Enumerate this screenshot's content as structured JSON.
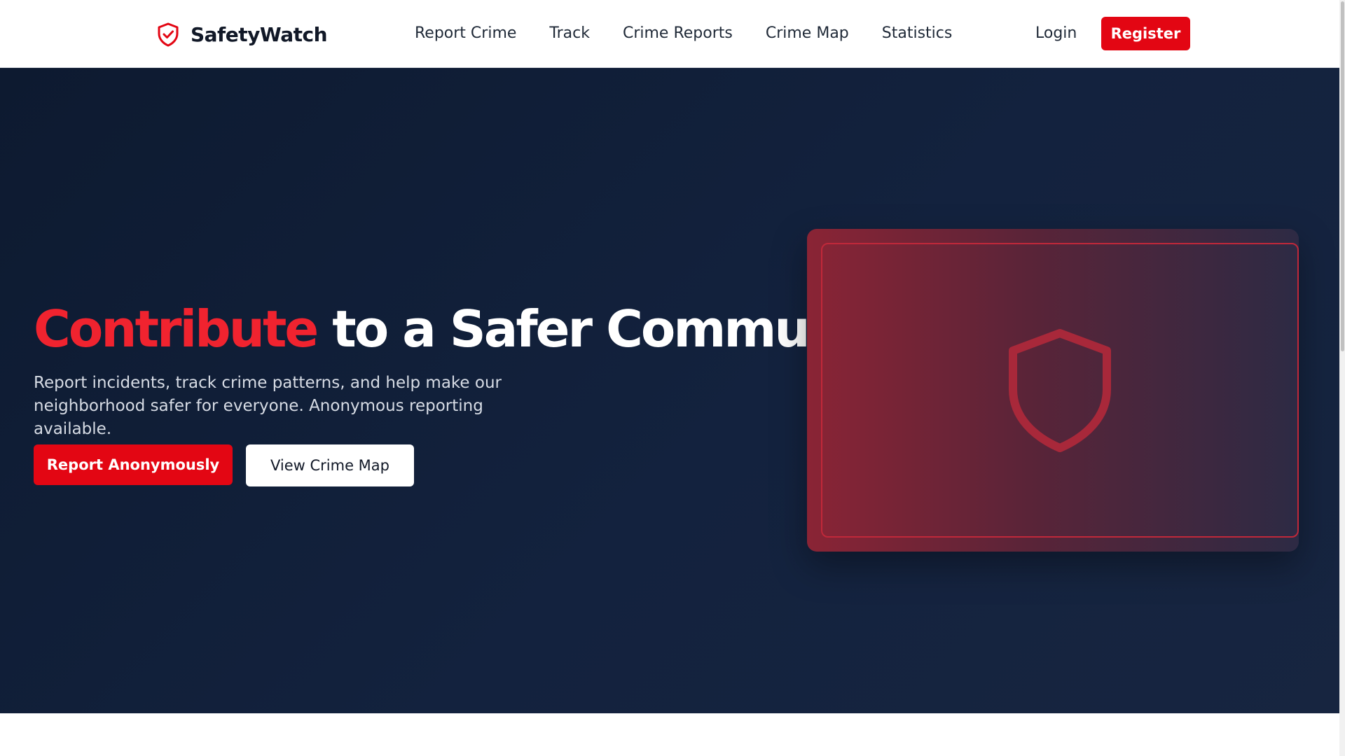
{
  "brand": {
    "name": "SafetyWatch",
    "icon": "shield-check-icon",
    "accent_color": "#e30613"
  },
  "nav": {
    "links": [
      {
        "label": "Report Crime"
      },
      {
        "label": "Track"
      },
      {
        "label": "Crime Reports"
      },
      {
        "label": "Crime Map"
      },
      {
        "label": "Statistics"
      }
    ],
    "login_label": "Login",
    "register_label": "Register"
  },
  "hero": {
    "title_accent": "Contribute",
    "title_rest": "to a Safer Community",
    "subtitle": "Report incidents, track crime patterns, and help make our neighborhood safer for everyone. Anonymous reporting available.",
    "primary_button": "Report Anonymously",
    "secondary_button": "View Crime Map",
    "card_icon": "shield-icon",
    "background_color": "#0f1d35"
  }
}
